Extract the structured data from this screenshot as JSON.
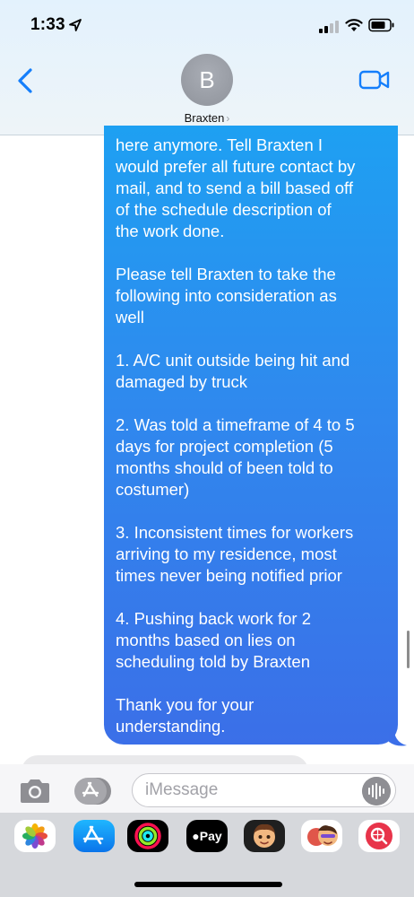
{
  "status_bar": {
    "time": "1:33"
  },
  "header": {
    "avatar_initial": "B",
    "contact_name": "Braxten",
    "contact_chevron": "›"
  },
  "message": {
    "paragraphs": [
      "here anymore. Tell Braxten I\nwould prefer all future contact by\nmail, and to send a bill based off\nof the schedule description of\nthe work done.",
      "Please tell Braxten to take the\nfollowing into consideration as\nwell",
      "1. A/C unit outside being hit and\ndamaged by truck",
      "2. Was told a timeframe of 4 to 5\ndays for project completion (5\nmonths should of been told to\ncostumer)",
      "3. Inconsistent times for workers\narriving to my residence, most\ntimes never being notified prior",
      "4. Pushing back work for 2\nmonths based on lies on\nscheduling told by Braxten",
      "Thank you for your\nunderstanding."
    ]
  },
  "input_bar": {
    "placeholder": "iMessage"
  },
  "app_drawer": {
    "apple_pay_label": "Pay",
    "apps": [
      "photos-icon",
      "app-store-icon",
      "fitness-icon",
      "apple-pay-icon",
      "memoji-icon",
      "stickers-icon",
      "web-search-icon"
    ]
  },
  "colors": {
    "bubble_top": "#1ea0f2",
    "bubble_bottom": "#3b6fe8",
    "accent": "#147efb"
  }
}
